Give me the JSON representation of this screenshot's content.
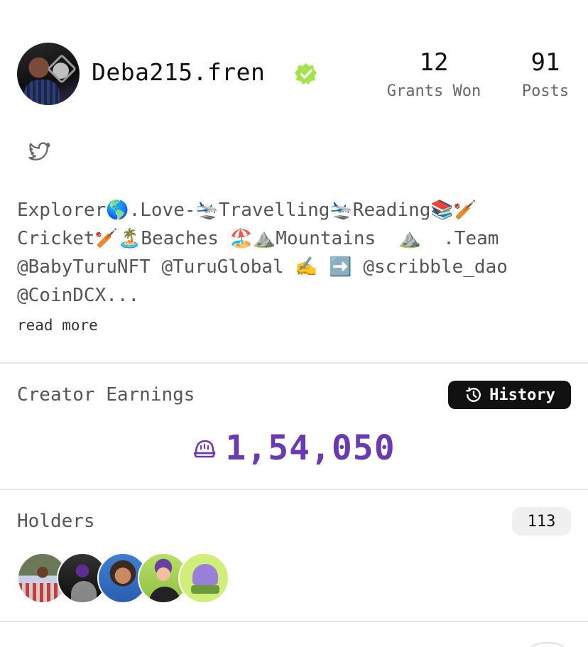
{
  "profile": {
    "username": "Deba215.fren",
    "verified": true,
    "avatar_icon": "user-avatar",
    "stats": [
      {
        "value": "12",
        "label": "Grants Won"
      },
      {
        "value": "91",
        "label": "Posts"
      }
    ]
  },
  "social": {
    "twitter_icon": "twitter-icon"
  },
  "bio": {
    "text": "Explorer🌎.Love-🛬Travelling🛬Reading📚🏏\nCricket🏏🏝️Beaches 🏖️⛰️Mountains  ⛰️  .Team\n@BabyTuruNFT @TuruGlobal ✍️ ➡️ @scribble_dao\n@CoinDCX...",
    "read_more": "read more"
  },
  "earnings": {
    "title": "Creator Earnings",
    "history_label": "History",
    "value": "1,54,050",
    "currency_icon": "degen-hat-icon",
    "accent_color": "#6a3bb0"
  },
  "holders": {
    "title": "Holders",
    "count": "113",
    "avatars": [
      "holder-1",
      "holder-2",
      "holder-3",
      "holder-4",
      "holder-5"
    ]
  },
  "colors": {
    "verified_badge": "#a4e34a",
    "history_bg": "#111111"
  }
}
